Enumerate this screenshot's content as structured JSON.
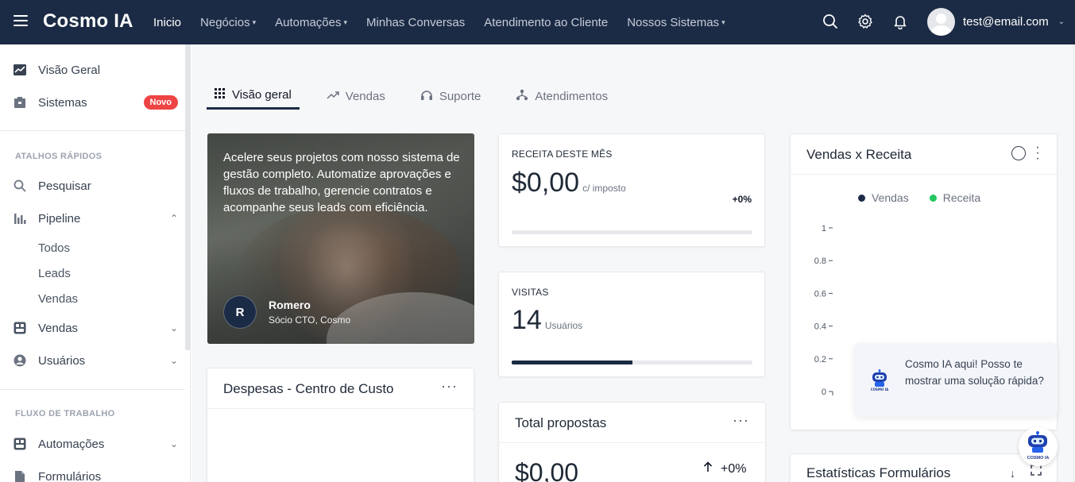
{
  "topbar": {
    "brand": "Cosmo IA",
    "nav": [
      {
        "label": "Inicio",
        "active": true,
        "dropdown": false
      },
      {
        "label": "Negócios",
        "active": false,
        "dropdown": true
      },
      {
        "label": "Automações",
        "active": false,
        "dropdown": true
      },
      {
        "label": "Minhas Conversas",
        "active": false,
        "dropdown": false
      },
      {
        "label": "Atendimento ao Cliente",
        "active": false,
        "dropdown": false
      },
      {
        "label": "Nossos Sistemas",
        "active": false,
        "dropdown": true
      }
    ],
    "user_email": "test@email.com",
    "icons": [
      "search-icon",
      "gear-icon",
      "bell-icon"
    ]
  },
  "sidebar": {
    "top_items": [
      {
        "label": "Visão Geral",
        "icon": "chart-line-icon"
      },
      {
        "label": "Sistemas",
        "icon": "box-icon",
        "badge": "Novo"
      }
    ],
    "section_shortcuts": "ATALHOS RÁPIDOS",
    "shortcuts": [
      {
        "label": "Pesquisar",
        "icon": "search-icon"
      },
      {
        "label": "Pipeline",
        "icon": "bar-chart-icon",
        "expanded": true
      },
      {
        "label": "Vendas",
        "icon": "dashboard-icon",
        "expanded": false
      },
      {
        "label": "Usuários",
        "icon": "user-circle-icon",
        "expanded": false
      }
    ],
    "pipeline_sub": [
      "Todos",
      "Leads",
      "Vendas"
    ],
    "section_workflow": "FLUXO DE TRABALHO",
    "workflow": [
      {
        "label": "Automações",
        "icon": "dashboard-icon"
      },
      {
        "label": "Formulários",
        "icon": "file-icon"
      }
    ]
  },
  "tabs": [
    {
      "label": "Visão geral",
      "icon": "grid-icon",
      "active": true
    },
    {
      "label": "Vendas",
      "icon": "trend-up-icon",
      "active": false
    },
    {
      "label": "Suporte",
      "icon": "headset-icon",
      "active": false
    },
    {
      "label": "Atendimentos",
      "icon": "network-icon",
      "active": false
    }
  ],
  "hero": {
    "text": "Acelere seus projetos com nosso sistema de gestão completo. Automatize aprovações e fluxos de trabalho, gerencie contratos e acompanhe seus leads com eficiência.",
    "avatar_initial": "R",
    "name": "Romero",
    "role": "Sócio CTO, Cosmo"
  },
  "revenue": {
    "label": "RECEITA DESTE MÊS",
    "value": "$0,00",
    "unit": "c/ imposto",
    "pct": "+0%",
    "progress": 0
  },
  "visits": {
    "label": "VISITAS",
    "value": "14",
    "unit": "Usuários",
    "progress": 0.5
  },
  "expenses": {
    "title": "Despesas - Centro de Custo"
  },
  "proposals": {
    "title": "Total propostas",
    "value": "$0,00",
    "pct": "+0%"
  },
  "forms_stats": {
    "title": "Estatísticas Formulários"
  },
  "chart_data": {
    "type": "line",
    "title": "Vendas x Receita",
    "series": [
      {
        "name": "Vendas",
        "color": "#1c2b45",
        "values": []
      },
      {
        "name": "Receita",
        "color": "#22c55e",
        "values": []
      }
    ],
    "yticks": [
      "1",
      "0.8",
      "0.6",
      "0.4",
      "0.2",
      "0"
    ],
    "ylim": [
      0,
      1
    ],
    "legend": "top"
  },
  "chatbot": {
    "message": "Cosmo IA aqui! Posso te mostrar uma solução rápida?",
    "robot_label": "COSMO IA"
  }
}
